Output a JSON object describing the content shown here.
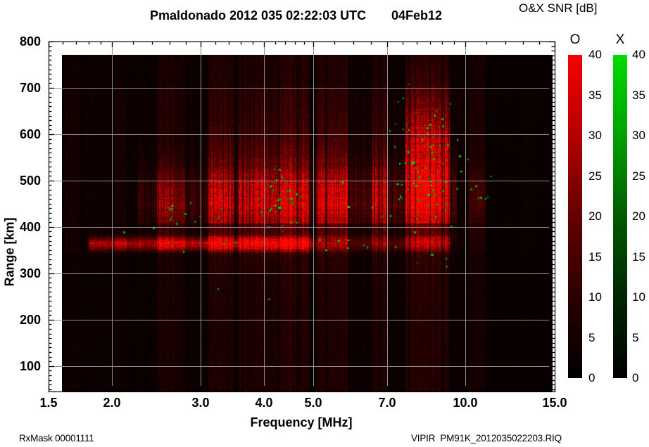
{
  "header": {
    "title": "Pmaldonado 2012 035 02:22:03 UTC",
    "date": "04Feb12"
  },
  "colorbar_panel": {
    "title": "O&X SNR [dB]"
  },
  "footer": {
    "left": "RxMask 00001111",
    "right": "VIPIR  PM91K_2012035022203.RIQ"
  },
  "chart_data": {
    "type": "heatmap",
    "title": "Pmaldonado 2012 035 02:22:03 UTC",
    "date_label": "04Feb12",
    "xlabel": "Frequency [MHz]",
    "ylabel": "Range [km]",
    "x_scale": "log",
    "xlim": [
      1.5,
      15.0
    ],
    "ylim": [
      45,
      800
    ],
    "grid": true,
    "grid_color": "#8f8f8f",
    "x_ticks": [
      {
        "v": 1.5,
        "label": "1.5"
      },
      {
        "v": 2.0,
        "label": "2.0"
      },
      {
        "v": 3.0,
        "label": "3.0"
      },
      {
        "v": 4.0,
        "label": "4.0"
      },
      {
        "v": 5.0,
        "label": "5.0"
      },
      {
        "v": 7.0,
        "label": "7.0"
      },
      {
        "v": 10.0,
        "label": "10.0"
      },
      {
        "v": 15.0,
        "label": "15.0"
      }
    ],
    "x_minor_ticks": [
      1.6,
      1.7,
      1.8,
      1.9,
      2.2,
      2.4,
      2.6,
      2.8,
      3.2,
      3.4,
      3.6,
      3.8,
      4.2,
      4.4,
      4.6,
      4.8,
      5.5,
      6.0,
      6.5,
      7.5,
      8.0,
      8.5,
      9.0,
      9.5,
      11.0,
      12.0,
      13.0,
      14.0
    ],
    "y_ticks": [
      800,
      700,
      600,
      500,
      400,
      300,
      200,
      100
    ],
    "y_minor_step": 10,
    "colorbars": [
      {
        "label": "O",
        "unit": "dB",
        "min": 0,
        "max": 40,
        "tick_step": 5,
        "ticks": [
          40,
          35,
          30,
          25,
          20,
          15,
          10,
          5,
          0
        ],
        "gradient": [
          "#f80000",
          "#b40000",
          "#640000",
          "#2a0000",
          "#000000"
        ]
      },
      {
        "label": "X",
        "unit": "dB",
        "min": 0,
        "max": 40,
        "tick_step": 5,
        "ticks": [
          40,
          35,
          30,
          25,
          20,
          15,
          10,
          5,
          0
        ],
        "gradient": [
          "#00dc00",
          "#00a000",
          "#005a00",
          "#002600",
          "#000000"
        ]
      }
    ],
    "features": {
      "description": "O-mode SNR shown as red intensity, X-mode echoes as green speckles; data span 1.6-15 MHz and 45-771 km",
      "noise": {
        "stripe": 0.33,
        "floor": 0.045,
        "base_band_amp": 0.1
      },
      "bands": [
        [
          1.62,
          1.74,
          0.2
        ],
        [
          1.78,
          1.96,
          0.14
        ],
        [
          2.03,
          2.14,
          0.22
        ],
        [
          2.18,
          2.32,
          0.12
        ],
        [
          2.46,
          2.64,
          0.42
        ],
        [
          2.64,
          2.8,
          0.3
        ],
        [
          2.86,
          3.06,
          0.14
        ],
        [
          3.1,
          3.48,
          0.46
        ],
        [
          3.56,
          4.28,
          0.44
        ],
        [
          4.3,
          4.9,
          0.58
        ],
        [
          5.08,
          5.85,
          0.5
        ],
        [
          5.9,
          6.5,
          0.16
        ],
        [
          6.55,
          7.02,
          0.48
        ],
        [
          7.06,
          7.52,
          0.15
        ],
        [
          7.58,
          9.3,
          0.58
        ],
        [
          9.4,
          9.95,
          0.14
        ],
        [
          10.15,
          10.95,
          0.28
        ],
        [
          11.0,
          15.0,
          0.07
        ]
      ],
      "echo_layers": [
        {
          "r": 363,
          "sigma": 9,
          "amp": 1.7,
          "f0": 1.8,
          "f1": 5.0
        },
        {
          "r": 363,
          "sigma": 9,
          "amp": 0.55,
          "f0": 5.0,
          "f1": 9.35
        }
      ],
      "echo_blobs": [
        {
          "r": 455,
          "sigma": 48,
          "amp": 1.25,
          "f0": 2.25,
          "f1": 9.6
        },
        {
          "r": 480,
          "sigma": 95,
          "amp": 0.38,
          "f0": 3.05,
          "f1": 9.6
        },
        {
          "r": 565,
          "sigma": 75,
          "amp": 0.9,
          "f0": 7.55,
          "f1": 9.35
        },
        {
          "r": 460,
          "sigma": 40,
          "amp": 0.55,
          "f0": 10.15,
          "f1": 10.95
        }
      ],
      "dark_lane": {
        "r0": 380,
        "r1": 408,
        "factor": 0.45
      },
      "x_mode_clusters": [
        {
          "f": 8.3,
          "r": 530,
          "f_spread": 0.035,
          "r_spread": 85,
          "count": 85
        },
        {
          "f": 4.35,
          "r": 465,
          "f_spread": 0.018,
          "r_spread": 35,
          "count": 28
        },
        {
          "f": 2.62,
          "r": 430,
          "f_spread": 0.008,
          "r_spread": 14,
          "count": 7
        },
        {
          "f": 10.5,
          "r": 470,
          "f_spread": 0.009,
          "r_spread": 18,
          "count": 5
        }
      ],
      "x_mode_scatter": [
        {
          "f0": 2.0,
          "f1": 7.4,
          "r0": 348,
          "r1": 380,
          "count": 13
        },
        {
          "f0": 2.8,
          "f1": 7.4,
          "r0": 392,
          "r1": 470,
          "count": 12
        },
        {
          "f0": 1.8,
          "f1": 12.0,
          "r0": 150,
          "r1": 700,
          "count": 10
        }
      ]
    }
  }
}
